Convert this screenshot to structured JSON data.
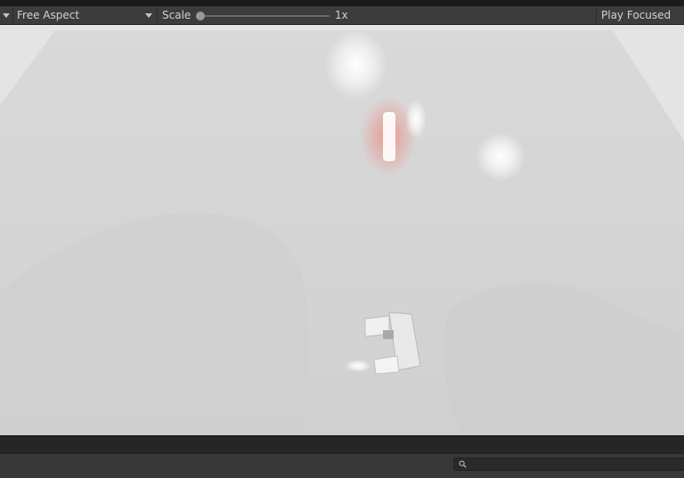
{
  "toolbar": {
    "aspect_label": "Free Aspect",
    "scale_label": "Scale",
    "scale_value": "1x",
    "scale_level": 0.0,
    "play_focused_label": "Play Focused"
  },
  "viewport": {
    "background_color": "#e2e2e2",
    "floor_color": "#d3d3d3",
    "accent_glow_color": "#ff4a3a"
  },
  "footer": {
    "search_value": "",
    "search_placeholder": ""
  },
  "icons": {
    "toolbar_menu": "chevron-down-icon",
    "aspect_caret": "chevron-down-icon",
    "search": "search-icon"
  }
}
